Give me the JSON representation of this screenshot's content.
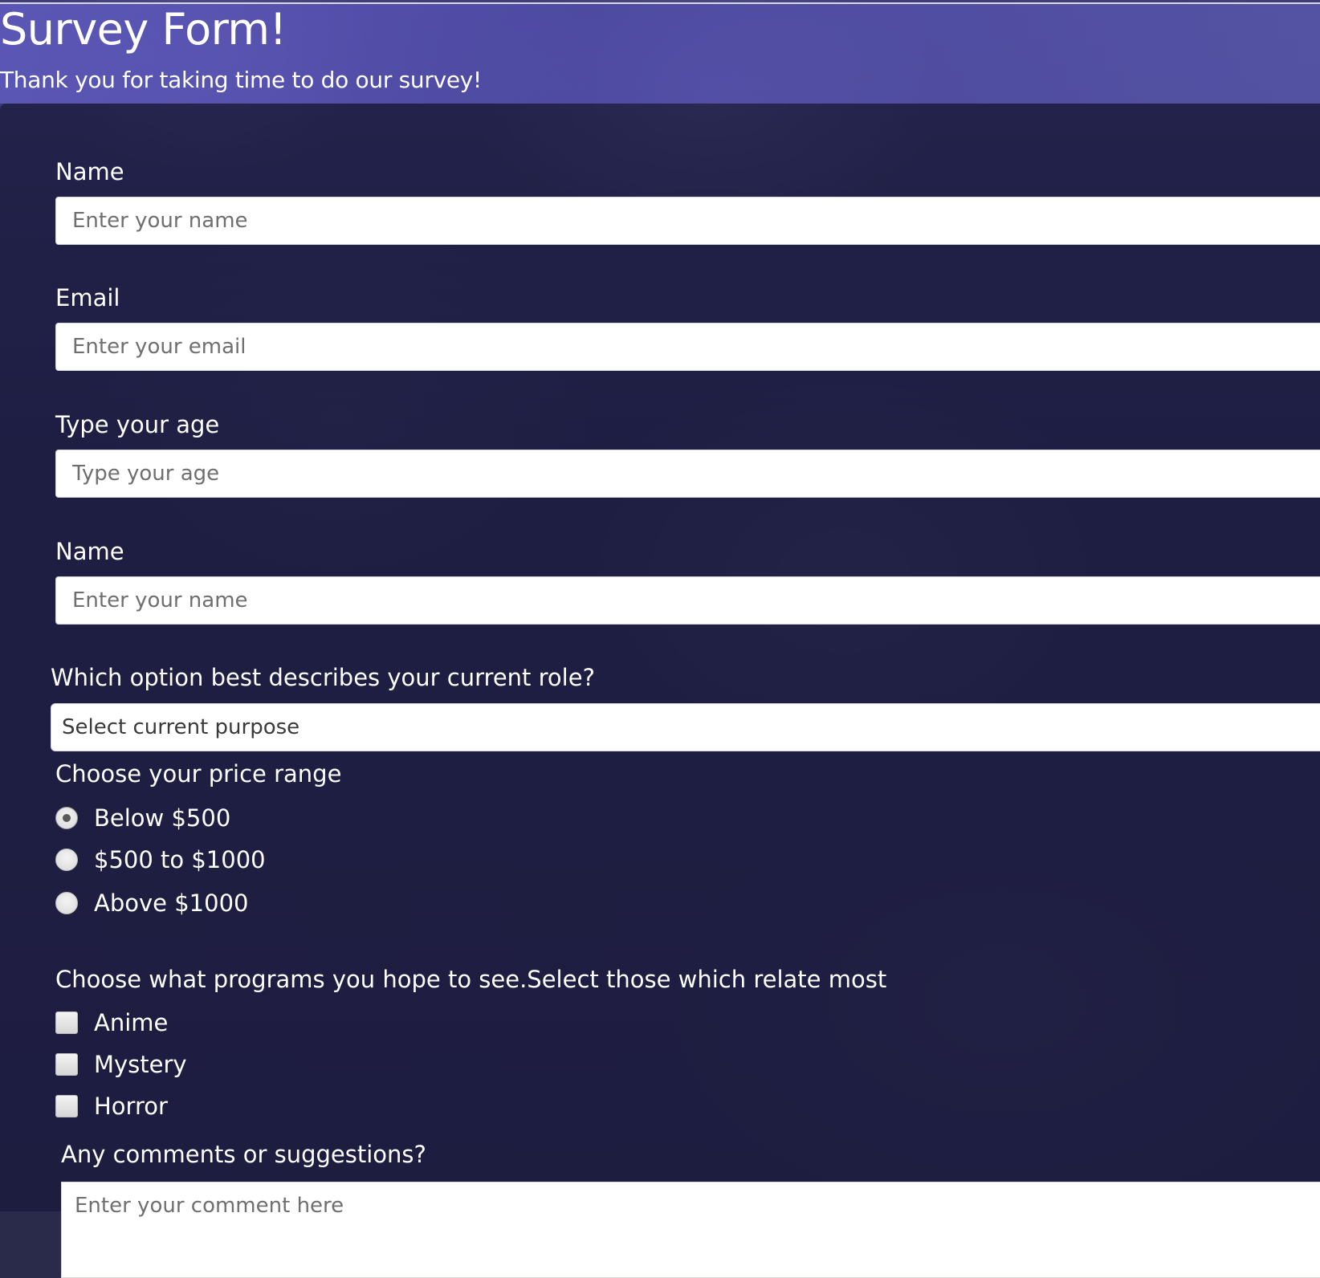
{
  "header": {
    "title": "Survey Form!",
    "subtitle": "Thank you for taking time to do our survey!"
  },
  "form": {
    "name": {
      "label": "Name",
      "placeholder": "Enter your name"
    },
    "email": {
      "label": "Email",
      "placeholder": "Enter your email"
    },
    "age": {
      "label": "Type your age",
      "placeholder": "Type your age"
    },
    "name2": {
      "label": "Name",
      "placeholder": "Enter your name"
    },
    "role": {
      "label": "Which option best describes your current role?",
      "selected": "Select current purpose"
    },
    "price": {
      "label": "Choose your price range",
      "options": [
        {
          "label": "Below $500",
          "checked": true
        },
        {
          "label": "$500 to $1000",
          "checked": false
        },
        {
          "label": "Above $1000",
          "checked": false
        }
      ]
    },
    "programs": {
      "label": "Choose what programs you hope to see.Select those which relate most",
      "options": [
        {
          "label": "Anime",
          "checked": false
        },
        {
          "label": "Mystery",
          "checked": false
        },
        {
          "label": "Horror",
          "checked": false
        }
      ]
    },
    "comments": {
      "label": "Any comments or suggestions?",
      "placeholder": "Enter your comment here"
    }
  },
  "colors": {
    "header_bg": "#5f5abe",
    "panel_bg": "#19193c",
    "text": "#ffffff",
    "input_bg": "#ffffff"
  }
}
